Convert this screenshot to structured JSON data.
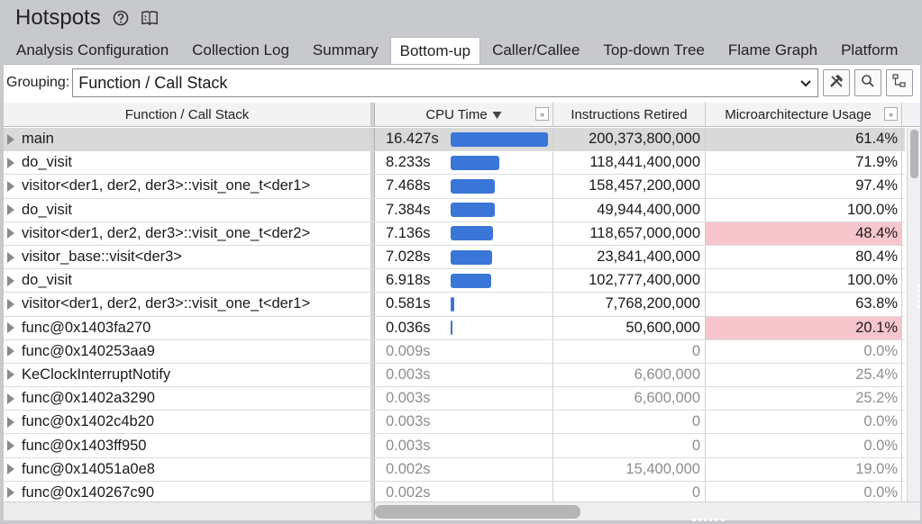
{
  "title": "Hotspots",
  "icons": {
    "help": "help-circle-icon",
    "docs": "book-icon"
  },
  "tabs": [
    "Analysis Configuration",
    "Collection Log",
    "Summary",
    "Bottom-up",
    "Caller/Callee",
    "Top-down Tree",
    "Flame Graph",
    "Platform"
  ],
  "active_tab": "Bottom-up",
  "grouping": {
    "label": "Grouping:",
    "value": "Function / Call Stack"
  },
  "columns": {
    "function": "Function / Call Stack",
    "cpu": "CPU Time",
    "instructions": "Instructions Retired",
    "uarch": "Microarchitecture Usage",
    "expand": "»"
  },
  "colors": {
    "bar": "#3a75d8",
    "highlight": "#f6c6cc"
  },
  "rows": [
    {
      "fn": "main",
      "cpu": "16.427s",
      "cpu_value": 16.427,
      "ins": "200,373,800,000",
      "uarch": "61.4%",
      "hl": false,
      "faded": false
    },
    {
      "fn": "do_visit",
      "cpu": "8.233s",
      "cpu_value": 8.233,
      "ins": "118,441,400,000",
      "uarch": "71.9%",
      "hl": false,
      "faded": false
    },
    {
      "fn": "visitor<der1, der2, der3>::visit_one_t<der1>",
      "cpu": "7.468s",
      "cpu_value": 7.468,
      "ins": "158,457,200,000",
      "uarch": "97.4%",
      "hl": false,
      "faded": false
    },
    {
      "fn": "do_visit",
      "cpu": "7.384s",
      "cpu_value": 7.384,
      "ins": "49,944,400,000",
      "uarch": "100.0%",
      "hl": false,
      "faded": false
    },
    {
      "fn": "visitor<der1, der2, der3>::visit_one_t<der2>",
      "cpu": "7.136s",
      "cpu_value": 7.136,
      "ins": "118,657,000,000",
      "uarch": "48.4%",
      "hl": true,
      "faded": false
    },
    {
      "fn": "visitor_base::visit<der3>",
      "cpu": "7.028s",
      "cpu_value": 7.028,
      "ins": "23,841,400,000",
      "uarch": "80.4%",
      "hl": false,
      "faded": false
    },
    {
      "fn": "do_visit",
      "cpu": "6.918s",
      "cpu_value": 6.918,
      "ins": "102,777,400,000",
      "uarch": "100.0%",
      "hl": false,
      "faded": false
    },
    {
      "fn": "visitor<der1, der2, der3>::visit_one_t<der1>",
      "cpu": "0.581s",
      "cpu_value": 0.581,
      "ins": "7,768,200,000",
      "uarch": "63.8%",
      "hl": false,
      "faded": false
    },
    {
      "fn": "func@0x1403fa270",
      "cpu": "0.036s",
      "cpu_value": 0.036,
      "ins": "50,600,000",
      "uarch": "20.1%",
      "hl": true,
      "faded": false
    },
    {
      "fn": "func@0x140253aa9",
      "cpu": "0.009s",
      "cpu_value": 0.009,
      "ins": "0",
      "uarch": "0.0%",
      "hl": false,
      "faded": true
    },
    {
      "fn": "KeClockInterruptNotify",
      "cpu": "0.003s",
      "cpu_value": 0.003,
      "ins": "6,600,000",
      "uarch": "25.4%",
      "hl": false,
      "faded": true
    },
    {
      "fn": "func@0x1402a3290",
      "cpu": "0.003s",
      "cpu_value": 0.003,
      "ins": "6,600,000",
      "uarch": "25.2%",
      "hl": false,
      "faded": true
    },
    {
      "fn": "func@0x1402c4b20",
      "cpu": "0.003s",
      "cpu_value": 0.003,
      "ins": "0",
      "uarch": "0.0%",
      "hl": false,
      "faded": true
    },
    {
      "fn": "func@0x1403ff950",
      "cpu": "0.003s",
      "cpu_value": 0.003,
      "ins": "0",
      "uarch": "0.0%",
      "hl": false,
      "faded": true
    },
    {
      "fn": "func@0x14051a0e8",
      "cpu": "0.002s",
      "cpu_value": 0.002,
      "ins": "15,400,000",
      "uarch": "19.0%",
      "hl": false,
      "faded": true
    },
    {
      "fn": "func@0x140267c90",
      "cpu": "0.002s",
      "cpu_value": 0.002,
      "ins": "0",
      "uarch": "0.0%",
      "hl": false,
      "faded": true
    }
  ]
}
